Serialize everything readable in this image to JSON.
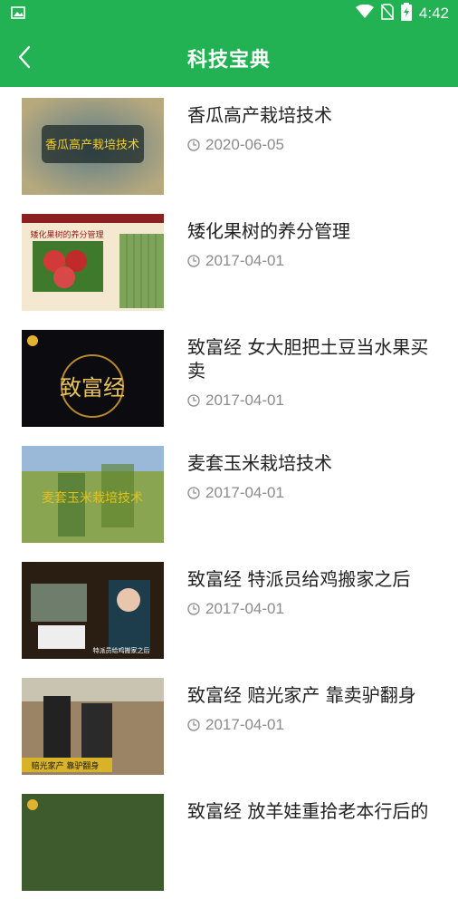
{
  "status_bar": {
    "time": "4:42",
    "icons": [
      "image-icon",
      "wifi-icon",
      "no-sim-icon",
      "battery-charging-icon"
    ]
  },
  "header": {
    "title": "科技宝典",
    "back_icon": "chevron-left-icon"
  },
  "items": [
    {
      "title": "香瓜高产栽培技术",
      "date": "2020-06-05",
      "thumb_text": "香瓜高产栽培技术"
    },
    {
      "title": "矮化果树的养分管理",
      "date": "2017-04-01",
      "thumb_text": "矮化果树的养分管理"
    },
    {
      "title": "致富经 女大胆把土豆当水果买卖",
      "date": "2017-04-01",
      "thumb_text": "致富经"
    },
    {
      "title": "麦套玉米栽培技术",
      "date": "2017-04-01",
      "thumb_text": "麦套玉米栽培技术"
    },
    {
      "title": "致富经 特派员给鸡搬家之后",
      "date": "2017-04-01",
      "thumb_text": "特派员给鸡搬家之后"
    },
    {
      "title": "致富经 赔光家产 靠卖驴翻身",
      "date": "2017-04-01",
      "thumb_text": "赔光家产 靠驴翻身"
    },
    {
      "title": "致富经 放羊娃重拾老本行后的",
      "date": "",
      "thumb_text": ""
    }
  ],
  "colors": {
    "primary": "#22b254",
    "title_text": "#222222",
    "date_text": "#8b8b8b"
  }
}
